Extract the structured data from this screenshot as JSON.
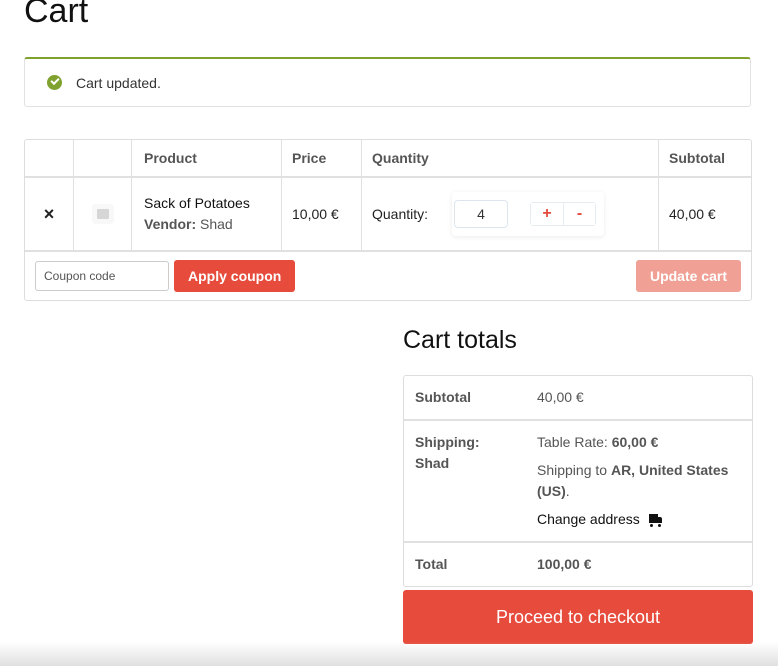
{
  "page": {
    "title": "Cart"
  },
  "notice": {
    "icon": "check-circle-icon",
    "text": "Cart updated.",
    "color": "#7fa12d"
  },
  "cart": {
    "headers": {
      "remove": "",
      "thumbnail": "",
      "product": "Product",
      "price": "Price",
      "quantity": "Quantity",
      "subtotal": "Subtotal"
    },
    "items": [
      {
        "remove_icon": "×",
        "name": "Sack of Potatoes",
        "vendor_label": "Vendor:",
        "vendor": "Shad",
        "price": "10,00 €",
        "quantity_label": "Quantity:",
        "quantity": "4",
        "plus": "+",
        "minus": "-",
        "subtotal": "40,00 €"
      }
    ],
    "coupon_placeholder": "Coupon code",
    "apply_coupon": "Apply coupon",
    "update_cart": "Update cart"
  },
  "totals": {
    "title": "Cart totals",
    "subtotal_label": "Subtotal",
    "subtotal": "40,00 €",
    "shipping_label_1": "Shipping:",
    "shipping_label_2": "Shad",
    "rate_label": "Table Rate: ",
    "rate": "60,00 €",
    "ship_to_label": "Shipping to ",
    "ship_to": "AR, United States (US)",
    "ship_to_suffix": ".",
    "change_address": "Change address",
    "total_label": "Total",
    "total": "100,00 €"
  },
  "checkout": {
    "label": "Proceed to checkout"
  },
  "colors": {
    "accent": "#e64b3c",
    "accent_disabled": "#f0a095",
    "success": "#7fa12d"
  }
}
